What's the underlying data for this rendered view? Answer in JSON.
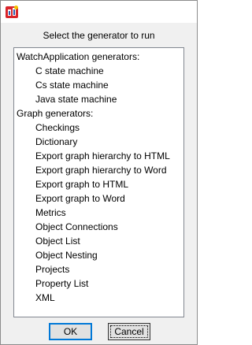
{
  "dialog": {
    "prompt": "Select the generator to run"
  },
  "icons": {
    "app": "app-logo-icon"
  },
  "colors": {
    "window_bg": "#f0f0f0",
    "list_bg": "#ffffff",
    "ok_border": "#0078d7",
    "logo_red": "#d9242a",
    "logo_blue": "#2a5db0",
    "logo_yellow": "#f2c200"
  },
  "generators": {
    "groups": [
      {
        "header": "WatchApplication generators:",
        "items": [
          "C state machine",
          "Cs state machine",
          "Java state machine"
        ]
      },
      {
        "header": "Graph generators:",
        "items": [
          "Checkings",
          "Dictionary",
          "Export graph hierarchy to HTML",
          "Export graph hierarchy to Word",
          "Export graph to HTML",
          "Export graph to Word",
          "Metrics",
          "Object Connections",
          "Object List",
          "Object Nesting",
          "Projects",
          "Property List",
          "XML"
        ]
      }
    ]
  },
  "buttons": {
    "ok_label": "OK",
    "cancel_label": "Cancel"
  }
}
